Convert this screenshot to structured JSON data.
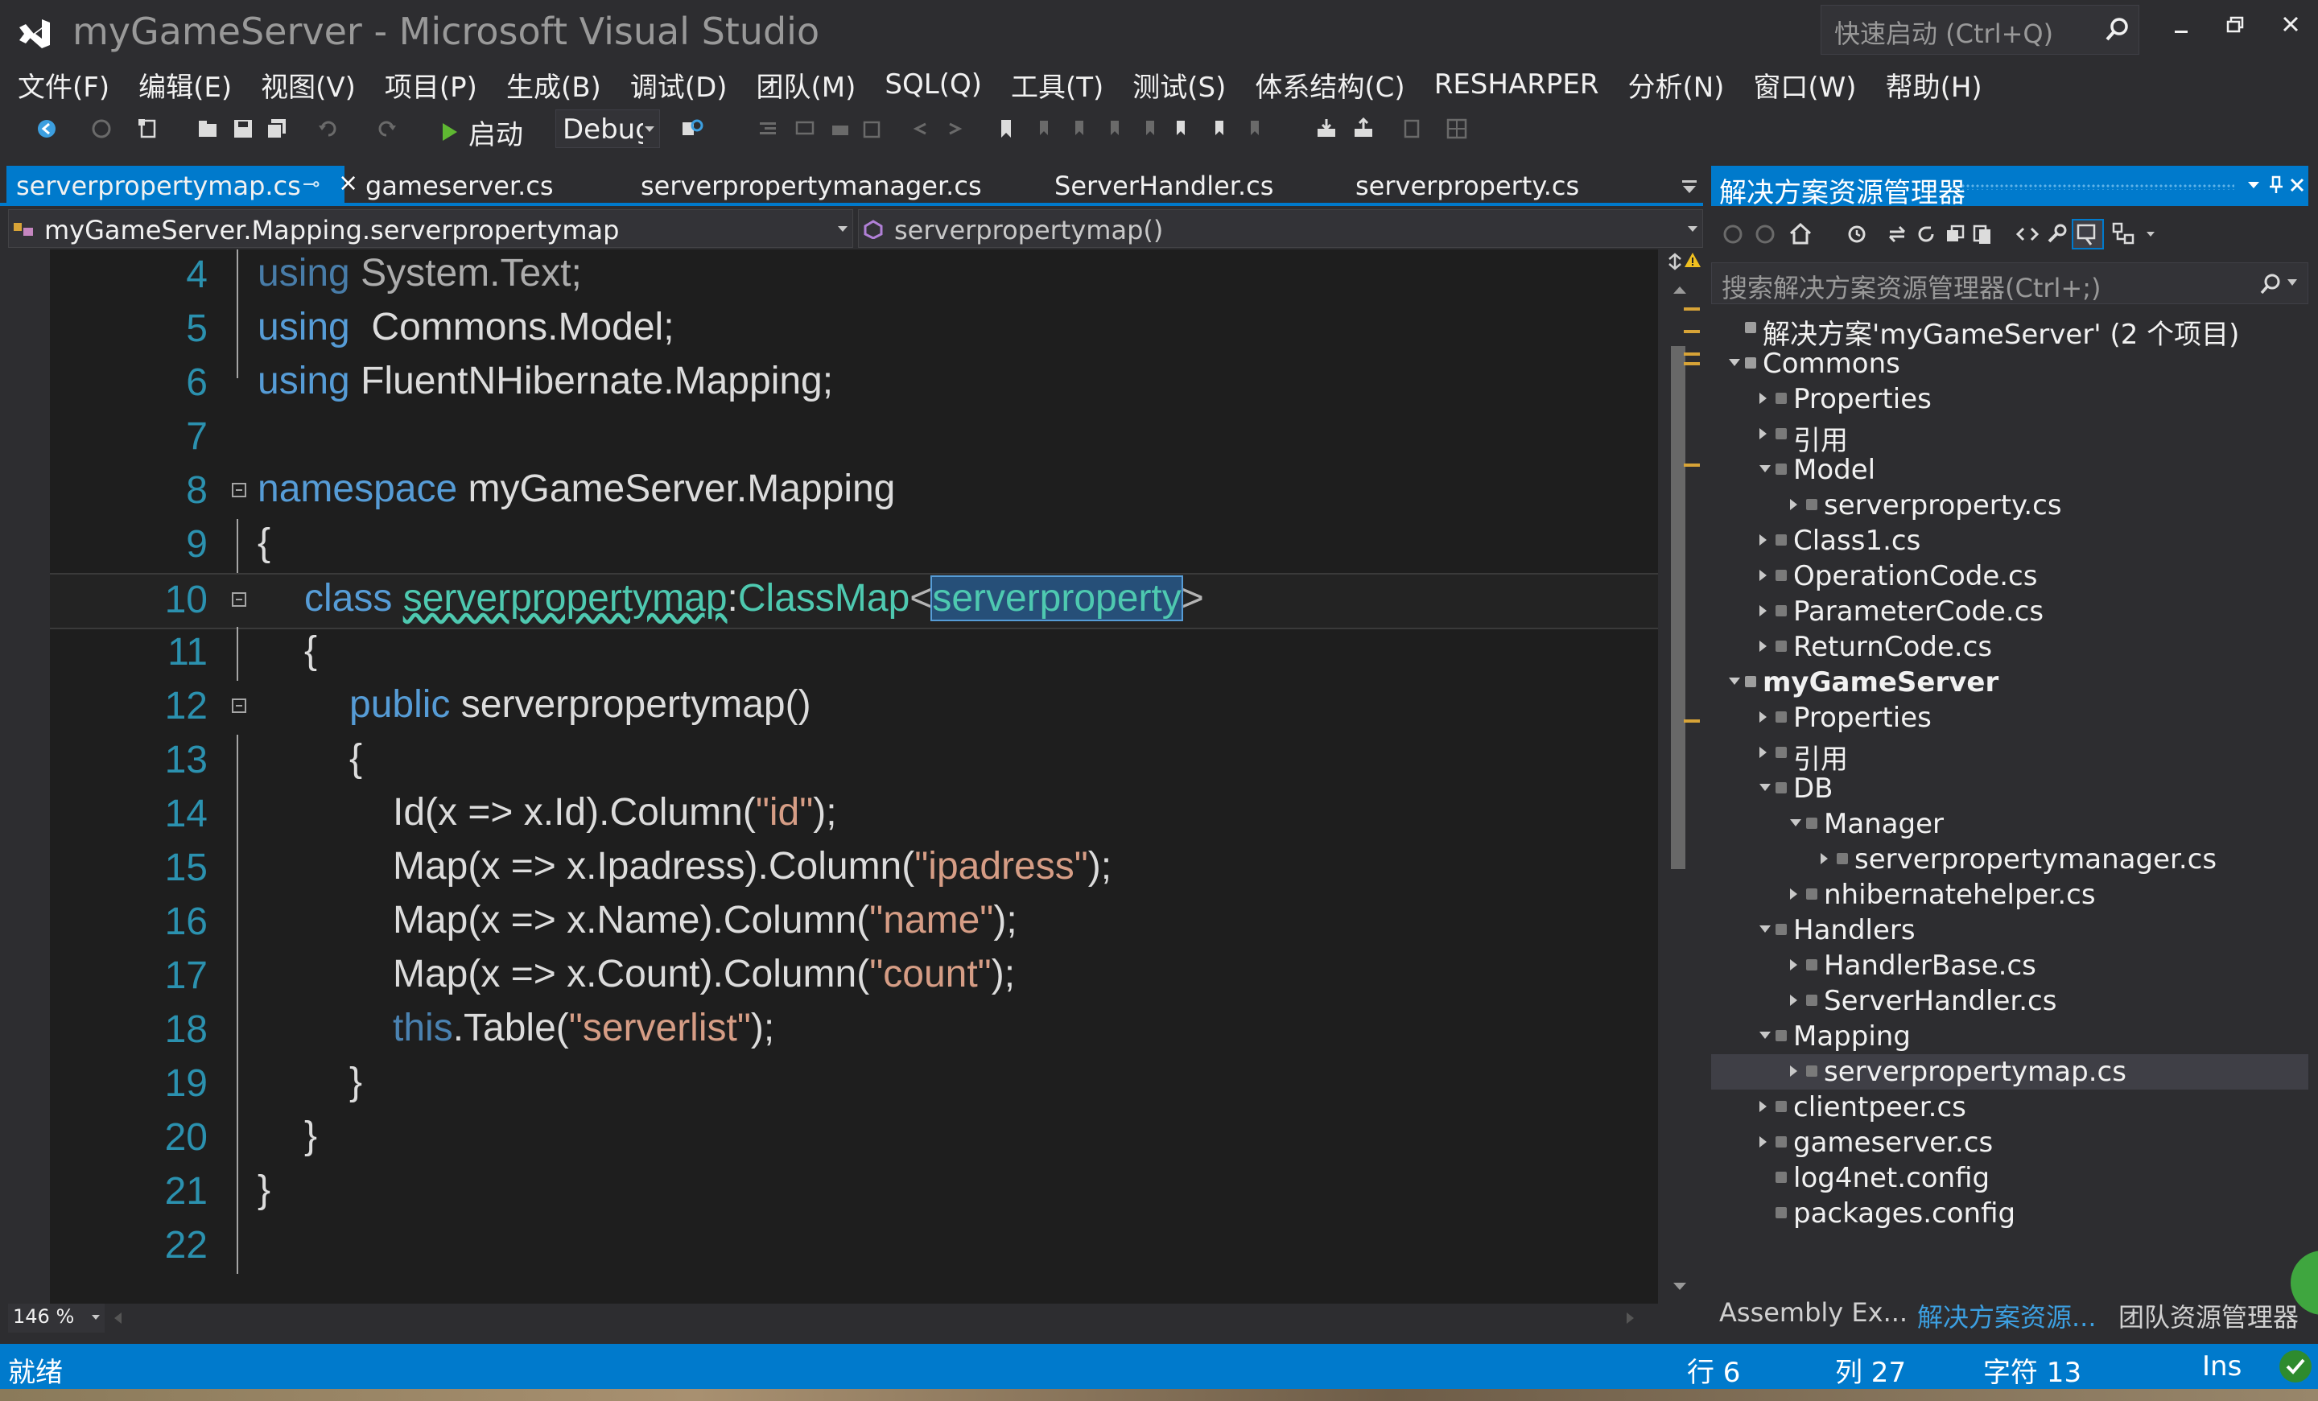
{
  "window": {
    "title": "myGameServer - Microsoft Visual Studio",
    "quick_launch_placeholder": "快速启动 (Ctrl+Q)"
  },
  "menu": [
    "文件(F)",
    "编辑(E)",
    "视图(V)",
    "项目(P)",
    "生成(B)",
    "调试(D)",
    "团队(M)",
    "SQL(Q)",
    "工具(T)",
    "测试(S)",
    "体系结构(C)",
    "RESHARPER",
    "分析(N)",
    "窗口(W)",
    "帮助(H)"
  ],
  "toolbar": {
    "start_label": "启动",
    "config_value": "Debug"
  },
  "tabs": [
    "serverpropertymap.cs",
    "gameserver.cs",
    "serverpropertymanager.cs",
    "ServerHandler.cs",
    "serverproperty.cs"
  ],
  "navbar": {
    "type_scope": "myGameServer.Mapping.serverpropertymap",
    "member_scope": "serverpropertymap()"
  },
  "editor": {
    "zoom": "146 %",
    "line_numbers": [
      "4",
      "5",
      "6",
      "7",
      "8",
      "9",
      "10",
      "11",
      "12",
      "13",
      "14",
      "15",
      "16",
      "17",
      "18",
      "19",
      "20",
      "21",
      "22"
    ],
    "tokens": {
      "using": "using",
      "l4_ns": " System.Text;",
      "l5_ns": "  Commons.Model;",
      "l6_ns": " FluentNHibernate.Mapping;",
      "namespace_kw": "namespace",
      "namespace_name": " myGameServer.Mapping",
      "open_brace": "{",
      "close_brace": "}",
      "class_kw": "class",
      "class_name": "serverpropertymap",
      "colon": ":",
      "base_type": "ClassMap",
      "lt": "<",
      "generic_arg": "serverproperty",
      "gt": ">",
      "public_kw": "public",
      "ctor_sig": " serverpropertymap()",
      "l14": "Id(x => x.Id).Column(",
      "l14_str": "\"id\"",
      "l15": "Map(x => x.Ipadress).Column(",
      "l15_str": "\"ipadress\"",
      "l16": "Map(x => x.Name).Column(",
      "l16_str": "\"name\"",
      "l17": "Map(x => x.Count).Column(",
      "l17_str": "\"count\"",
      "this_kw": "this",
      "l18": ".Table(",
      "l18_str": "\"serverlist\"",
      "call_end": ");"
    }
  },
  "solution_explorer": {
    "title": "解决方案资源管理器",
    "search_placeholder": "搜索解决方案资源管理器(Ctrl+;)",
    "tree": [
      {
        "label": "解决方案'myGameServer' (2 个项目)",
        "depth": 0,
        "state": "none"
      },
      {
        "label": "Commons",
        "depth": 0,
        "state": "expanded"
      },
      {
        "label": "Properties",
        "depth": 1,
        "state": "collapsed"
      },
      {
        "label": "引用",
        "depth": 1,
        "state": "collapsed"
      },
      {
        "label": "Model",
        "depth": 1,
        "state": "expanded"
      },
      {
        "label": "serverproperty.cs",
        "depth": 2,
        "state": "collapsed"
      },
      {
        "label": "Class1.cs",
        "depth": 1,
        "state": "collapsed"
      },
      {
        "label": "OperationCode.cs",
        "depth": 1,
        "state": "collapsed"
      },
      {
        "label": "ParameterCode.cs",
        "depth": 1,
        "state": "collapsed"
      },
      {
        "label": "ReturnCode.cs",
        "depth": 1,
        "state": "collapsed"
      },
      {
        "label": "myGameServer",
        "depth": 0,
        "state": "expanded"
      },
      {
        "label": "Properties",
        "depth": 1,
        "state": "collapsed"
      },
      {
        "label": "引用",
        "depth": 1,
        "state": "collapsed"
      },
      {
        "label": "DB",
        "depth": 1,
        "state": "expanded"
      },
      {
        "label": "Manager",
        "depth": 2,
        "state": "expanded"
      },
      {
        "label": "serverpropertymanager.cs",
        "depth": 3,
        "state": "collapsed"
      },
      {
        "label": "nhibernatehelper.cs",
        "depth": 2,
        "state": "collapsed"
      },
      {
        "label": "Handlers",
        "depth": 1,
        "state": "expanded"
      },
      {
        "label": "HandlerBase.cs",
        "depth": 2,
        "state": "collapsed"
      },
      {
        "label": "ServerHandler.cs",
        "depth": 2,
        "state": "collapsed"
      },
      {
        "label": "Mapping",
        "depth": 1,
        "state": "expanded"
      },
      {
        "label": "serverpropertymap.cs",
        "depth": 2,
        "state": "collapsed"
      },
      {
        "label": "clientpeer.cs",
        "depth": 1,
        "state": "collapsed"
      },
      {
        "label": "gameserver.cs",
        "depth": 1,
        "state": "collapsed"
      },
      {
        "label": "log4net.config",
        "depth": 1,
        "state": "none"
      },
      {
        "label": "packages.config",
        "depth": 1,
        "state": "none"
      }
    ],
    "bottom_tabs": [
      "Assembly Ex...",
      "解决方案资源...",
      "团队资源管理器"
    ]
  },
  "status": {
    "ready": "就绪",
    "line": "行 6",
    "col": "列 27",
    "char": "字符 13",
    "mode": "Ins"
  },
  "colors": {
    "accent": "#007acc",
    "keyword": "#569cd6",
    "type": "#4ec9b0",
    "string": "#d69d85",
    "line_number": "#2b91af"
  }
}
